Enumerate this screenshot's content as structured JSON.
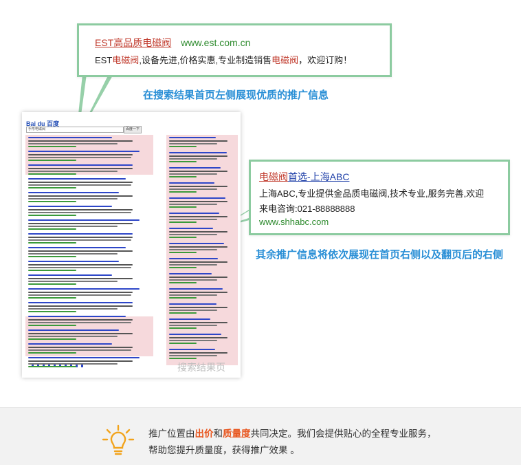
{
  "top_ad": {
    "title_link": "EST高品质电磁阀",
    "url": "www.est.com.cn",
    "desc": [
      "EST",
      "电磁阀",
      ",设备先进,价格实惠,专业制造销售",
      "电磁阀",
      "，欢迎订购！"
    ]
  },
  "captions": {
    "left_ads": "在搜索结果首页左侧展现优质的推广信息",
    "right_ads": "其余推广信息将依次展现在首页右侧以及翻页后的右侧"
  },
  "right_ad": {
    "title_link_red": "电磁阀",
    "title_link_blue": "首选-上海ABC",
    "desc_line1": "上海ABC,专业提供金品质电磁阀,技术专业,服务完善,欢迎",
    "desc_line2": "来电咨询:021-88888888",
    "url": "www.shhabc.com"
  },
  "serp": {
    "logo": "Bai du 百度",
    "watermark": "搜索结果页",
    "search_button": "百度一下",
    "query": "手形电磁阀",
    "brand_colors": {
      "logo": "#2b54b8",
      "highlight": "#f6d9dc",
      "link": "#2d46c8",
      "green": "#3a9a3a"
    }
  },
  "footer": {
    "line1_a": "推广位置由",
    "line1_b": "出价",
    "line1_c": "和",
    "line1_d": "质量度",
    "line1_e": "共同决定。我们会提供贴心的全程专业服务，",
    "line2": "帮助您提升质量度，获得推广效果 。",
    "icon": "lightbulb-icon",
    "accent": "#e8541c"
  }
}
